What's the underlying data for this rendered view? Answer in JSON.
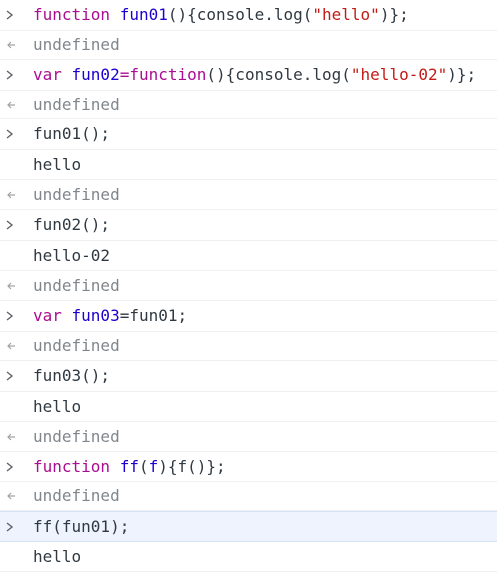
{
  "entries": [
    {
      "kind": "input",
      "tokens": [
        {
          "t": "function ",
          "c": "kw"
        },
        {
          "t": "fun01",
          "c": "fn"
        },
        {
          "t": "(){console.log(",
          "c": "op"
        },
        {
          "t": "\"hello\"",
          "c": "str"
        },
        {
          "t": ")};",
          "c": "op"
        }
      ]
    },
    {
      "kind": "return",
      "text": "undefined"
    },
    {
      "kind": "input",
      "tokens": [
        {
          "t": "var ",
          "c": "kw"
        },
        {
          "t": "fun02",
          "c": "fn"
        },
        {
          "t": "=",
          "c": "kw"
        },
        {
          "t": "function",
          "c": "kw"
        },
        {
          "t": "(){console.log(",
          "c": "op"
        },
        {
          "t": "\"hello-02\"",
          "c": "str"
        },
        {
          "t": ")};",
          "c": "op"
        }
      ]
    },
    {
      "kind": "return",
      "text": "undefined"
    },
    {
      "kind": "input",
      "tokens": [
        {
          "t": "fun01();",
          "c": "op"
        }
      ]
    },
    {
      "kind": "output",
      "text": "hello"
    },
    {
      "kind": "return",
      "text": "undefined"
    },
    {
      "kind": "input",
      "tokens": [
        {
          "t": "fun02();",
          "c": "op"
        }
      ]
    },
    {
      "kind": "output",
      "text": "hello-02"
    },
    {
      "kind": "return",
      "text": "undefined"
    },
    {
      "kind": "input",
      "tokens": [
        {
          "t": "var ",
          "c": "kw"
        },
        {
          "t": "fun03",
          "c": "fn"
        },
        {
          "t": "=fun01;",
          "c": "op"
        }
      ]
    },
    {
      "kind": "return",
      "text": "undefined"
    },
    {
      "kind": "input",
      "tokens": [
        {
          "t": "fun03();",
          "c": "op"
        }
      ]
    },
    {
      "kind": "output",
      "text": "hello"
    },
    {
      "kind": "return",
      "text": "undefined"
    },
    {
      "kind": "input",
      "tokens": [
        {
          "t": "function ",
          "c": "kw"
        },
        {
          "t": "ff",
          "c": "fn"
        },
        {
          "t": "(",
          "c": "op"
        },
        {
          "t": "f",
          "c": "fn"
        },
        {
          "t": "){f()};",
          "c": "op"
        }
      ]
    },
    {
      "kind": "return",
      "text": "undefined"
    },
    {
      "kind": "input",
      "highlight": true,
      "tokens": [
        {
          "t": "ff(fun01);",
          "c": "op"
        }
      ]
    },
    {
      "kind": "output",
      "text": "hello"
    }
  ]
}
